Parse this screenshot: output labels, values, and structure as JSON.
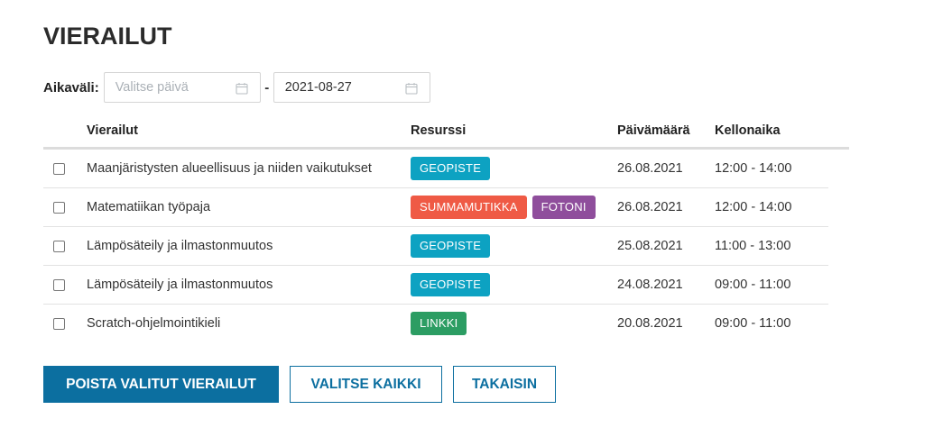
{
  "page": {
    "title": "VIERAILUT"
  },
  "filter": {
    "label": "Aikaväli:",
    "start_placeholder": "Valitse päivä",
    "separator": "-",
    "end_value": "2021-08-27",
    "icons": [
      "calendar-icon",
      "calendar-icon"
    ]
  },
  "table": {
    "headers": {
      "name": "Vierailut",
      "resource": "Resurssi",
      "date": "Päivämäärä",
      "time": "Kellonaika"
    },
    "rows": [
      {
        "name": "Maanjäristysten alueellisuus ja niiden vaikutukset",
        "resources": [
          {
            "label": "GEOPISTE",
            "color": "#0da2c2"
          }
        ],
        "date": "26.08.2021",
        "time": "12:00 - 14:00",
        "checked": false
      },
      {
        "name": "Matematiikan työpaja",
        "resources": [
          {
            "label": "SUMMAMUTIKKA",
            "color": "#ef5a45"
          },
          {
            "label": "FOTONI",
            "color": "#8f4e9c"
          }
        ],
        "date": "26.08.2021",
        "time": "12:00 - 14:00",
        "checked": false
      },
      {
        "name": "Lämpösäteily ja ilmastonmuutos",
        "resources": [
          {
            "label": "GEOPISTE",
            "color": "#0da2c2"
          }
        ],
        "date": "25.08.2021",
        "time": "11:00 - 13:00",
        "checked": false
      },
      {
        "name": "Lämpösäteily ja ilmastonmuutos",
        "resources": [
          {
            "label": "GEOPISTE",
            "color": "#0da2c2"
          }
        ],
        "date": "24.08.2021",
        "time": "09:00 - 11:00",
        "checked": false
      },
      {
        "name": "Scratch-ohjelmointikieli",
        "resources": [
          {
            "label": "LINKKI",
            "color": "#2c9d63"
          }
        ],
        "date": "20.08.2021",
        "time": "09:00 - 11:00",
        "checked": false
      }
    ]
  },
  "actions": {
    "delete_selected": "POISTA VALITUT VIERAILUT",
    "select_all": "VALITSE KAIKKI",
    "back": "TAKAISIN"
  },
  "colors": {
    "primary": "#0c6fa0"
  }
}
